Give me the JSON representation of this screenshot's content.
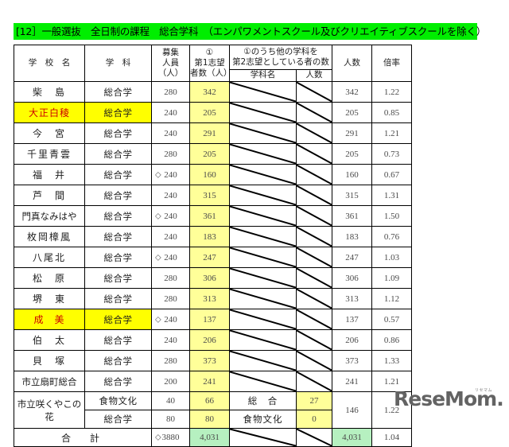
{
  "banner": {
    "title": "[12］一般選抜　全日制の課程　総合学科　（エンパワメントスクール及びクリエイティブスクールを除く）"
  },
  "table": {
    "headers": {
      "school": "学　校　名",
      "course": "学　科",
      "quota_line1": "募集",
      "quota_line2": "人員",
      "quota_line3": "（人）",
      "first_line1": "①",
      "first_line2": "第1志望",
      "first_line3": "者数（人）",
      "second_group_line1": "①のうち他の学科を",
      "second_group_line2": "第2志望としている者の数",
      "second_dept": "学科名",
      "second_count": "人数",
      "num": "人数",
      "ratio": "倍率"
    },
    "rows": [
      {
        "school": "柴　島",
        "course": "総合学",
        "diamond": "",
        "quota": "280",
        "first": "342",
        "dept": "",
        "cnt": "",
        "num": "342",
        "ratio": "1.22",
        "highlight": false
      },
      {
        "school": "大正白稜",
        "course": "総合学",
        "diamond": "",
        "quota": "240",
        "first": "205",
        "dept": "",
        "cnt": "",
        "num": "205",
        "ratio": "0.85",
        "highlight": true
      },
      {
        "school": "今　宮",
        "course": "総合学",
        "diamond": "",
        "quota": "240",
        "first": "291",
        "dept": "",
        "cnt": "",
        "num": "291",
        "ratio": "1.21",
        "highlight": false
      },
      {
        "school": "千里青雲",
        "course": "総合学",
        "diamond": "",
        "quota": "280",
        "first": "205",
        "dept": "",
        "cnt": "",
        "num": "205",
        "ratio": "0.73",
        "highlight": false
      },
      {
        "school": "福　井",
        "course": "総合学",
        "diamond": "◇",
        "quota": "240",
        "first": "160",
        "dept": "",
        "cnt": "",
        "num": "160",
        "ratio": "0.67",
        "highlight": false
      },
      {
        "school": "芦　間",
        "course": "総合学",
        "diamond": "",
        "quota": "240",
        "first": "315",
        "dept": "",
        "cnt": "",
        "num": "315",
        "ratio": "1.31",
        "highlight": false
      },
      {
        "school": "門真なみはや",
        "course": "総合学",
        "diamond": "◇",
        "quota": "240",
        "first": "361",
        "dept": "",
        "cnt": "",
        "num": "361",
        "ratio": "1.50",
        "highlight": false
      },
      {
        "school": "枚岡樟風",
        "course": "総合学",
        "diamond": "",
        "quota": "240",
        "first": "183",
        "dept": "",
        "cnt": "",
        "num": "183",
        "ratio": "0.76",
        "highlight": false
      },
      {
        "school": "八尾北",
        "course": "総合学",
        "diamond": "◇",
        "quota": "240",
        "first": "247",
        "dept": "",
        "cnt": "",
        "num": "247",
        "ratio": "1.03",
        "highlight": false
      },
      {
        "school": "松　原",
        "course": "総合学",
        "diamond": "",
        "quota": "280",
        "first": "306",
        "dept": "",
        "cnt": "",
        "num": "306",
        "ratio": "1.09",
        "highlight": false
      },
      {
        "school": "堺　東",
        "course": "総合学",
        "diamond": "",
        "quota": "280",
        "first": "313",
        "dept": "",
        "cnt": "",
        "num": "313",
        "ratio": "1.12",
        "highlight": false
      },
      {
        "school": "成　美",
        "course": "総合学",
        "diamond": "◇",
        "quota": "240",
        "first": "137",
        "dept": "",
        "cnt": "",
        "num": "137",
        "ratio": "0.57",
        "highlight": true
      },
      {
        "school": "伯　太",
        "course": "総合学",
        "diamond": "",
        "quota": "240",
        "first": "206",
        "dept": "",
        "cnt": "",
        "num": "206",
        "ratio": "0.86",
        "highlight": false
      },
      {
        "school": "貝　塚",
        "course": "総合学",
        "diamond": "",
        "quota": "280",
        "first": "373",
        "dept": "",
        "cnt": "",
        "num": "373",
        "ratio": "1.33",
        "highlight": false
      },
      {
        "school": "市立扇町総合",
        "course": "総合学",
        "diamond": "",
        "quota": "200",
        "first": "241",
        "dept": "",
        "cnt": "",
        "num": "241",
        "ratio": "1.21",
        "highlight": false
      }
    ],
    "merged_school": {
      "school": "市立咲くやこの花",
      "sub_rows": [
        {
          "course": "食物文化",
          "quota": "40",
          "first": "66",
          "dept": "総　合",
          "cnt": "27"
        },
        {
          "course": "総合学",
          "quota": "80",
          "first": "80",
          "dept": "食物文化",
          "cnt": "0"
        }
      ],
      "num": "146",
      "ratio": "1.22"
    },
    "total": {
      "label": "合　計",
      "diamond": "◇",
      "quota": "3880",
      "first": "4,031",
      "num": "4,031",
      "ratio": "1.04"
    }
  },
  "logo": {
    "part1": "Rese",
    "part2": "M",
    "part3": "o",
    "part4": "m",
    "period": ".",
    "kana": "リセマム"
  },
  "colors": {
    "banner_green": "#00ee00",
    "highlight_yellow": "#ffff00",
    "cell_yellow": "#ffff99",
    "total_green": "#b6f0c0",
    "highlight_text_red": "#cc0000"
  }
}
